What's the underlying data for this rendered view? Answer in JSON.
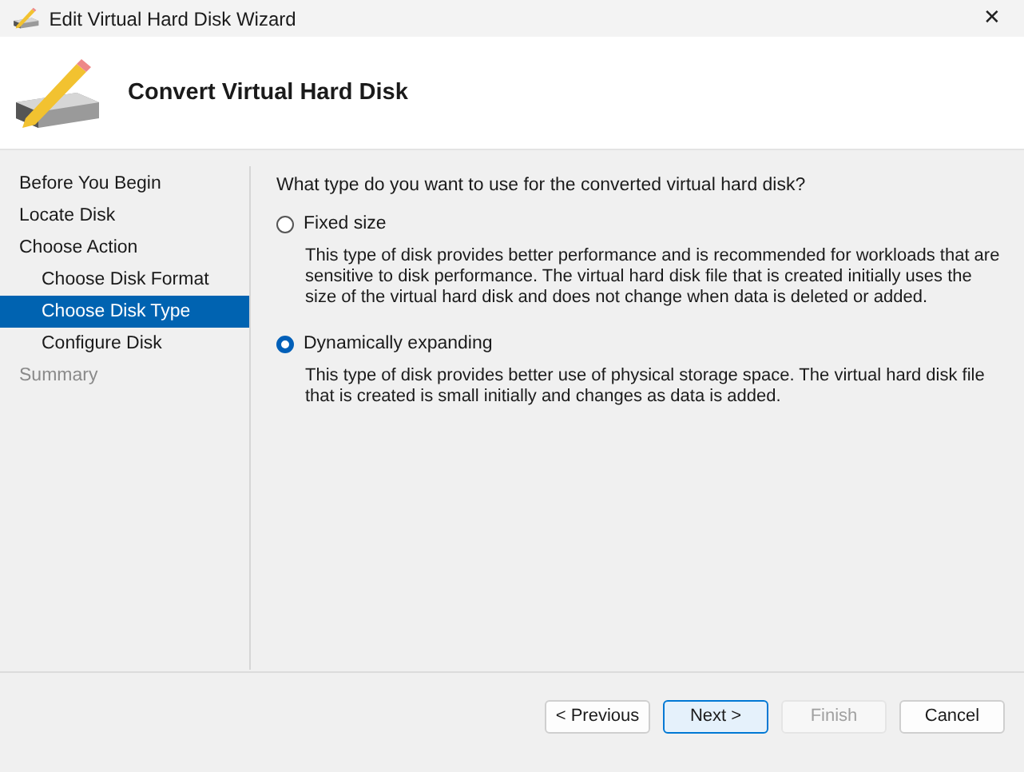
{
  "window": {
    "title": "Edit Virtual Hard Disk Wizard",
    "close": "✕"
  },
  "header": {
    "title": "Convert Virtual Hard Disk"
  },
  "steps": [
    {
      "label": "Before You Begin",
      "selected": false,
      "disabled": false
    },
    {
      "label": "Locate Disk",
      "selected": false,
      "disabled": false
    },
    {
      "label": "Choose Action",
      "selected": false,
      "disabled": false,
      "children": [
        {
          "label": "Choose Disk Format",
          "selected": false,
          "disabled": false
        },
        {
          "label": "Choose Disk Type",
          "selected": true,
          "disabled": false
        },
        {
          "label": "Configure Disk",
          "selected": false,
          "disabled": false
        }
      ]
    },
    {
      "label": "Summary",
      "selected": false,
      "disabled": true
    }
  ],
  "question": "What type do you want to use for the converted virtual hard disk?",
  "options": [
    {
      "label": "Fixed size",
      "selected": false,
      "description": "This type of disk provides better performance and is recommended for workloads that are sensitive to disk performance. The virtual hard disk file that is created initially uses the size of the virtual hard disk and does not change when data is deleted or added."
    },
    {
      "label": "Dynamically expanding",
      "selected": true,
      "description": "This type of disk provides better use of physical storage space. The virtual hard disk file that is created is small initially and changes as data is added."
    }
  ],
  "buttons": [
    {
      "label": "< Previous",
      "disabled": false,
      "focused": false
    },
    {
      "label": "Next >",
      "disabled": false,
      "focused": true
    },
    {
      "label": "Finish",
      "disabled": true,
      "focused": false
    },
    {
      "label": "Cancel",
      "disabled": false,
      "focused": false
    }
  ]
}
